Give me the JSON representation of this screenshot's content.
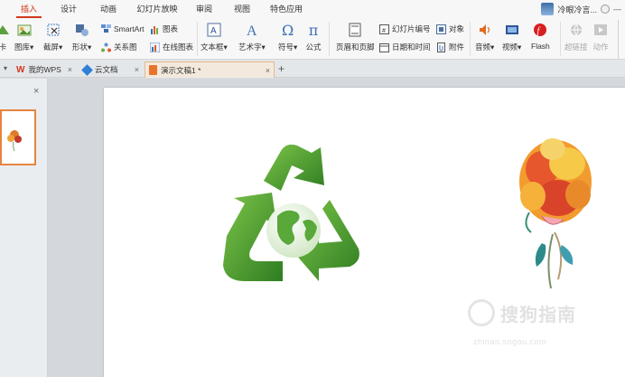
{
  "menubar": {
    "tabs": [
      {
        "label": "插入",
        "active": true
      },
      {
        "label": "设计",
        "active": false
      },
      {
        "label": "动画",
        "active": false
      },
      {
        "label": "幻灯片放映",
        "active": false
      },
      {
        "label": "审阅",
        "active": false
      },
      {
        "label": "视图",
        "active": false
      },
      {
        "label": "特色应用",
        "active": false
      }
    ],
    "user_name": "冷眼冷言..."
  },
  "ribbon": {
    "gallery": "图库",
    "screenshot": "截屏",
    "shapes": "形状",
    "smartart": "SmartArt",
    "chart": "图表",
    "relation": "关系图",
    "online_chart": "在线图表",
    "textbox": "文本框",
    "wordart": "艺术字",
    "symbol": "符号",
    "formula": "公式",
    "header_footer": "页眉和页脚",
    "slide_number": "幻灯片编号",
    "object": "对象",
    "date_time": "日期和时间",
    "attachment": "附件",
    "audio": "音频",
    "video": "视频",
    "flash": "Flash",
    "hyperlink": "超链接",
    "action": "动作"
  },
  "doctabs": {
    "tabs": [
      {
        "label": "我的WPS"
      },
      {
        "label": "云文档"
      },
      {
        "label": "演示文稿1 *",
        "active": true
      }
    ]
  },
  "watermark": {
    "text": "搜狗指南",
    "url": "zhinan.sogou.com"
  },
  "colors": {
    "accent": "#d2371b",
    "recycle_green": "#4ea132",
    "active_tab_border": "#e6843f"
  }
}
